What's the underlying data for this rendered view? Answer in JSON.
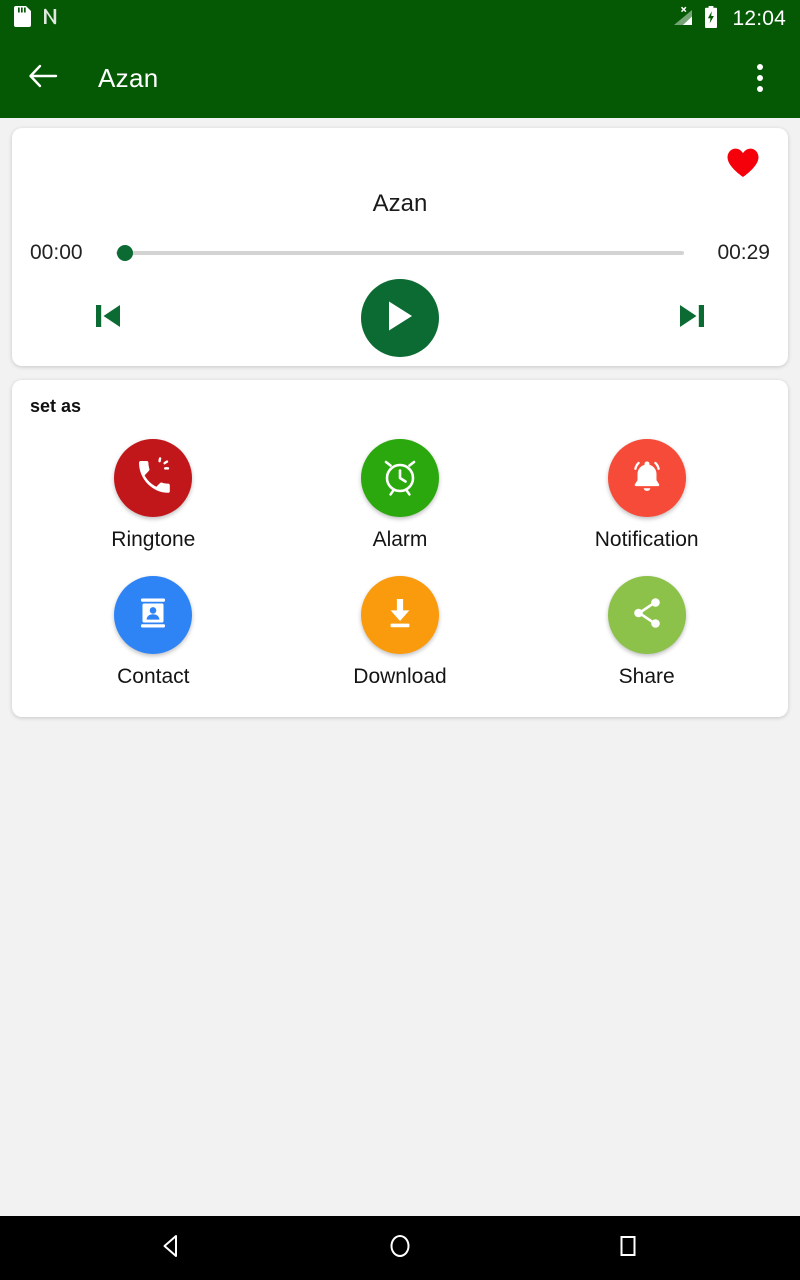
{
  "status_bar": {
    "icons": [
      "sd-card-icon",
      "nfc-icon",
      "signal-no-sim-icon",
      "battery-charging-icon"
    ],
    "time": "12:04",
    "background": "#055904"
  },
  "app_bar": {
    "back_icon": "back-arrow-icon",
    "title": "Azan",
    "overflow_icon": "overflow-menu-icon",
    "background": "#055904"
  },
  "player": {
    "favorite_icon": "heart-filled-icon",
    "favorite_color": "#f5000a",
    "track_title": "Azan",
    "current_time": "00:00",
    "total_time": "00:29",
    "progress_percent": 0,
    "accent_color": "#0b6b33",
    "previous_icon": "skip-previous-icon",
    "play_icon": "play-icon",
    "next_icon": "skip-next-icon"
  },
  "set_as": {
    "section_title": "set as",
    "actions": [
      {
        "label": "Ringtone",
        "icon": "ringtone-icon",
        "color": "#c1171b"
      },
      {
        "label": "Alarm",
        "icon": "alarm-clock-icon",
        "color": "#2ba80e"
      },
      {
        "label": "Notification",
        "icon": "bell-icon",
        "color": "#f64b38"
      },
      {
        "label": "Contact",
        "icon": "contact-card-icon",
        "color": "#2f84f5"
      },
      {
        "label": "Download",
        "icon": "download-icon",
        "color": "#f99b0c"
      },
      {
        "label": "Share",
        "icon": "share-icon",
        "color": "#8cc14a"
      }
    ]
  },
  "nav_bar": {
    "back_label": "back-triangle-icon",
    "home_label": "home-circle-icon",
    "recents_label": "recents-square-icon"
  }
}
